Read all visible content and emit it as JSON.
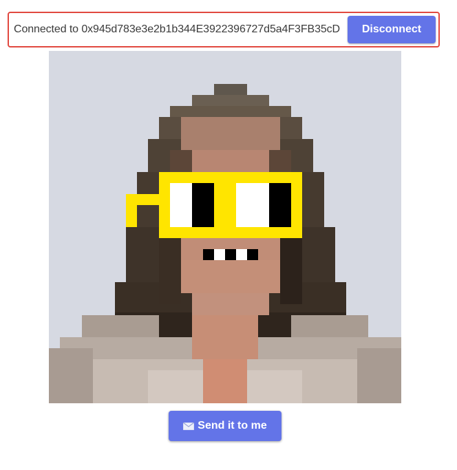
{
  "connection": {
    "text": "Connected to 0x945d783e3e2b1b344E3922396727d5a4F3FB35cD",
    "disconnect_label": "Disconnect",
    "border_color": "#e1483f"
  },
  "image": {
    "description_icon": "pixel-avatar-image",
    "background_color": "#d6d9e2",
    "glasses_color": "#ffe500"
  },
  "send": {
    "icon": "envelope-icon",
    "label": "Send it to me"
  },
  "accent_color": "#6374e8"
}
